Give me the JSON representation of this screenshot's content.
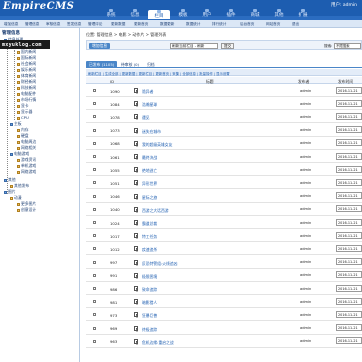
{
  "header": {
    "logo": "EmpireCMS",
    "user_text": "用户: admin"
  },
  "topnav": [
    {
      "label": "系统",
      "active": false
    },
    {
      "label": "信息",
      "active": false
    },
    {
      "label": "栏目",
      "active": true
    },
    {
      "label": "模板",
      "active": false
    },
    {
      "label": "用户",
      "active": false
    },
    {
      "label": "插件",
      "active": false
    },
    {
      "label": "商城",
      "active": false
    },
    {
      "label": "其他",
      "active": false
    },
    {
      "label": "扩展",
      "active": false
    }
  ],
  "subnav": [
    "增加信息",
    "管理信息",
    "审核信息",
    "签发信息",
    "管理评论",
    "更新数据",
    "更新首页",
    "数据更新",
    "数据统计",
    "排行统计",
    "后台首页",
    "网站首页",
    "退出"
  ],
  "watermark": "mxyuklog.com",
  "sidebar": {
    "title": "管理信息",
    "items": [
      "信息处理",
      "新闻中心",
      "国内新闻",
      "国际新闻",
      "社会新闻",
      "娱乐新闻",
      "体育新闻",
      "财经新闻",
      "科技新闻",
      "电脑配件",
      "市场行情",
      "显卡",
      "显示器",
      "CPU",
      "主板",
      "内存",
      "硬盘",
      "电脑周边",
      "网络相关",
      "电脑游戏",
      "游戏资讯",
      "单机游戏",
      "网络游戏",
      "其他",
      "其他发布",
      "图片",
      "动漫",
      "更多图片",
      "创意设计"
    ]
  },
  "breadcrumb": "位置: 管理信息 > 电影 > 动作片 > 管理列表",
  "toolbar": {
    "add_label": "增加信息",
    "select_value": "刷新当前栏目 - 刷新",
    "go_label": "提交",
    "search_label": "搜索:",
    "search_value": "不限搜索"
  },
  "tabs": [
    "已发布 (1105)",
    "待审核 (0)",
    "归档"
  ],
  "filters": "刷新栏目 | 生成全部 | 更新数据 | 更新栏目 | 更新首页 | 采集 | 全部信息 | 批量操作 | 显示设置",
  "table": {
    "headers": {
      "id": "ID",
      "title": "标题",
      "author": "发布者",
      "date": "发布时间"
    },
    "rows": [
      {
        "id": "1090",
        "title": "诡异者",
        "author": "admin",
        "date": "2016-11-21"
      },
      {
        "id": "1084",
        "title": "浩瀚星球",
        "author": "admin",
        "date": "2016-11-21"
      },
      {
        "id": "1078",
        "title": "遇见",
        "author": "admin",
        "date": "2016-11-21"
      },
      {
        "id": "1073",
        "title": "迷失在城市",
        "author": "admin",
        "date": "2016-11-21"
      },
      {
        "id": "1068",
        "title": "我的超级英雄女友",
        "author": "admin",
        "date": "2016-11-21"
      },
      {
        "id": "1061",
        "title": "最终决战",
        "author": "admin",
        "date": "2016-11-21"
      },
      {
        "id": "1055",
        "title": "绝地逃亡",
        "author": "admin",
        "date": "2016-11-21"
      },
      {
        "id": "1051",
        "title": "异形世界",
        "author": "admin",
        "date": "2016-11-21"
      },
      {
        "id": "1046",
        "title": "星际之旅",
        "author": "admin",
        "date": "2016-11-21"
      },
      {
        "id": "1040",
        "title": "西游之大话西游",
        "author": "admin",
        "date": "2016-11-21"
      },
      {
        "id": "1024",
        "title": "霸道总裁",
        "author": "admin",
        "date": "2016-11-21"
      },
      {
        "id": "1017",
        "title": "特工任务",
        "author": "admin",
        "date": "2016-11-21"
      },
      {
        "id": "1012",
        "title": "疾速追杀",
        "author": "admin",
        "date": "2016-11-21"
      },
      {
        "id": "997",
        "title": "反恐特警组:火线追凶",
        "author": "admin",
        "date": "2016-11-21"
      },
      {
        "id": "991",
        "title": "极限困境",
        "author": "admin",
        "date": "2016-11-21"
      },
      {
        "id": "986",
        "title": "致命追踪",
        "author": "admin",
        "date": "2016-11-21"
      },
      {
        "id": "981",
        "title": "暗影猎人",
        "author": "admin",
        "date": "2016-11-21"
      },
      {
        "id": "973",
        "title": "狂暴巨兽",
        "author": "admin",
        "date": "2016-11-21"
      },
      {
        "id": "969",
        "title": "终极追踪",
        "author": "admin",
        "date": "2016-11-21"
      },
      {
        "id": "963",
        "title": "危机边缘:重启之战",
        "author": "admin",
        "date": "2016-11-21"
      }
    ]
  }
}
